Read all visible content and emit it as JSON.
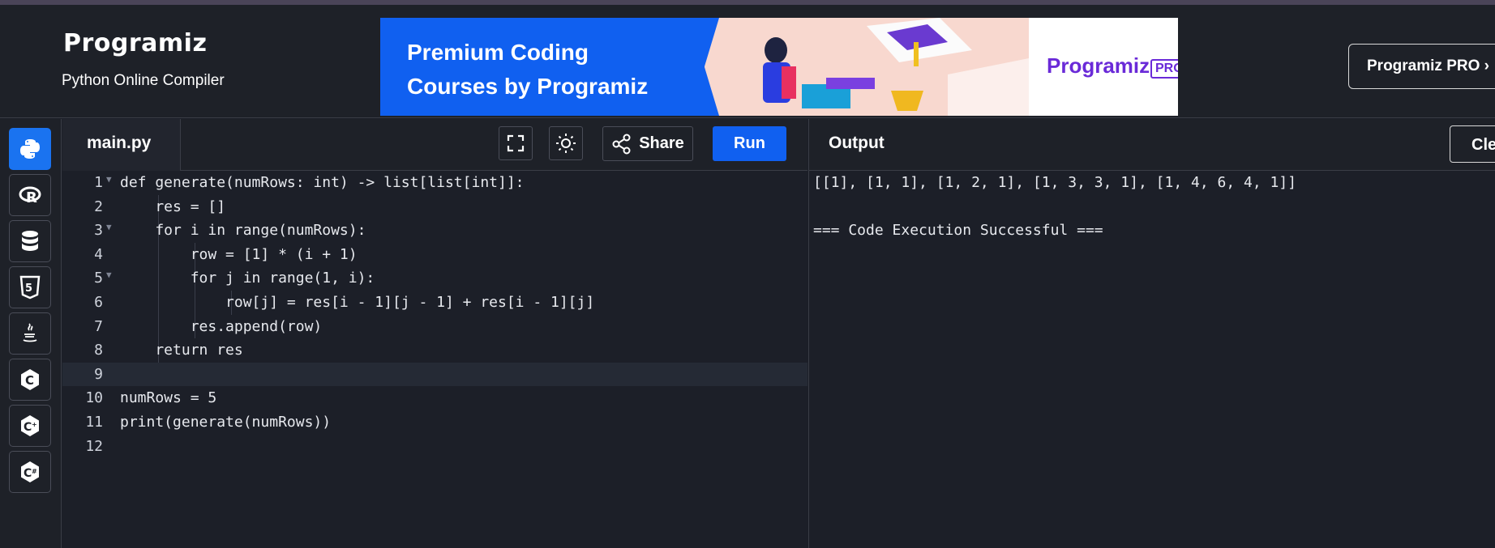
{
  "header": {
    "logo_text": "Programiz",
    "subtitle": "Python Online Compiler",
    "ad": {
      "title": "Premium Coding\nCourses by Programiz",
      "brand": "Programiz",
      "brand_badge": "PRO"
    },
    "pro_button": "Programiz PRO ›"
  },
  "sidebar": {
    "languages": [
      {
        "name": "python",
        "icon": "python-icon",
        "active": true
      },
      {
        "name": "r",
        "icon": "r-icon",
        "active": false
      },
      {
        "name": "sql",
        "icon": "database-icon",
        "active": false
      },
      {
        "name": "html",
        "icon": "html5-icon",
        "active": false
      },
      {
        "name": "java",
        "icon": "java-icon",
        "active": false
      },
      {
        "name": "c",
        "icon": "c-icon",
        "active": false
      },
      {
        "name": "cpp",
        "icon": "cpp-icon",
        "active": false
      },
      {
        "name": "csharp",
        "icon": "csharp-icon",
        "active": false
      }
    ]
  },
  "editor": {
    "filename": "main.py",
    "share_label": "Share",
    "run_label": "Run",
    "lines": [
      "def generate(numRows: int) -> list[list[int]]:",
      "    res = []",
      "    for i in range(numRows):",
      "        row = [1] * (i + 1)",
      "        for j in range(1, i):",
      "            row[j] = res[i - 1][j - 1] + res[i - 1][j]",
      "        res.append(row)",
      "    return res",
      "",
      "numRows = 5",
      "print(generate(numRows))",
      ""
    ],
    "line_numbers": [
      "1",
      "2",
      "3",
      "4",
      "5",
      "6",
      "7",
      "8",
      "9",
      "10",
      "11",
      "12"
    ]
  },
  "output": {
    "title": "Output",
    "clear_label": "Clear",
    "lines": [
      "[[1], [1, 1], [1, 2, 1], [1, 3, 3, 1], [1, 4, 6, 4, 1]]",
      "",
      "=== Code Execution Successful ==="
    ]
  }
}
